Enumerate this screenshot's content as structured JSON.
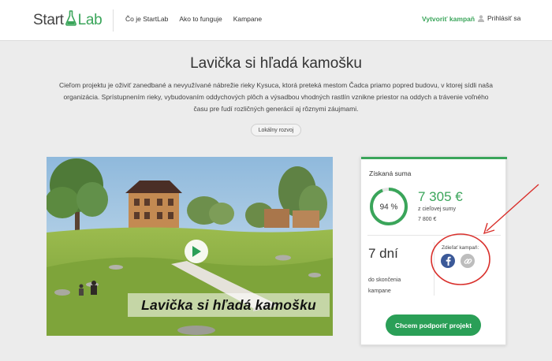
{
  "header": {
    "logo_start": "Start",
    "logo_lab": "Lab",
    "nav": [
      "Čo je StartLab",
      "Ako to funguje",
      "Kampane"
    ],
    "create_campaign": "Vytvoriť kampaň",
    "login": "Prihlásiť sa"
  },
  "campaign": {
    "title": "Lavička si hľadá kamošku",
    "description": "Cieľom projektu je oživiť zanedbané a nevyužívané nábrežie rieky Kysuca, ktorá preteká mestom Čadca priamo popred budovu, v ktorej sídli naša organizácia. Sprístupnením rieky, vybudovaním oddychových plôch a výsadbou vhodných rastlín vznikne priestor na oddych a trávenie voľného času pre ľudí rozličných generácií aj rôznymi záujmami.",
    "tag": "Lokálny rozvoj",
    "video_caption": "Lavička si hľadá kamošku"
  },
  "card": {
    "raised_label": "Získaná suma",
    "progress_text": "94 %",
    "progress_fraction": 0.94,
    "amount": "7 305 €",
    "goal_label": "z cieľovej sumy",
    "goal_value": "7 800 €",
    "days": "7 dní",
    "days_label": "do skončenia kampane",
    "share_label": "Zdieľať kampaň:",
    "support_button": "Chcem podporiť projekt"
  },
  "icons": {
    "logo": "flask-icon",
    "login": "user-icon",
    "play": "play-icon",
    "facebook": "facebook-icon",
    "copy": "link-icon"
  },
  "colors": {
    "brand_green": "#3aa55a",
    "button_green": "#2a9f57",
    "facebook_blue": "#3b5998",
    "annotation_red": "#d9302c"
  }
}
